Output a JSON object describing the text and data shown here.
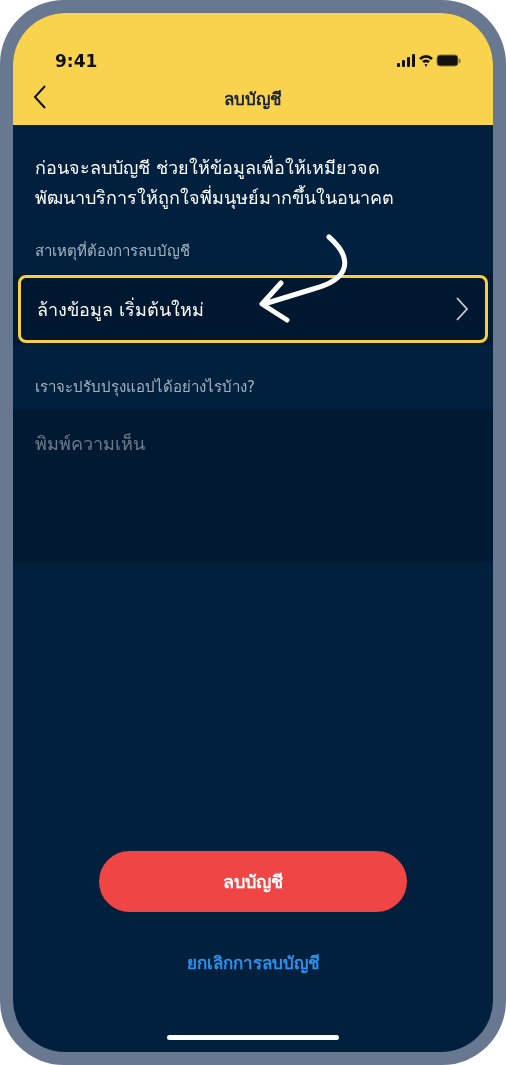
{
  "status_bar": {
    "time": "9:41"
  },
  "nav": {
    "title": "ลบบัญชี"
  },
  "intro": "ก่อนจะลบบัญชี ช่วยให้ข้อมูลเพื่อให้เหมียวจด\nพัฒนาบริการให้ถูกใจพี่มนุษย์มากขึ้นในอนาคต",
  "reason": {
    "label": "สาเหตุที่ต้องการลบบัญชี",
    "value": "ล้างข้อมูล เริ่มต้นใหม่",
    "highlighted": true
  },
  "feedback": {
    "label": "เราจะปรับปรุงแอปได้อย่างไรบ้าง?",
    "placeholder": "พิมพ์ความเห็น"
  },
  "delete_button": "ลบบัญชี",
  "cancel_link": "ยกเลิกการลบบัญชี"
}
